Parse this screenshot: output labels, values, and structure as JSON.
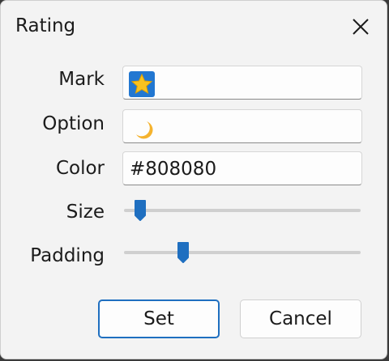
{
  "dialog": {
    "title": "Rating",
    "fields": {
      "mark_label": "Mark",
      "option_label": "Option",
      "color_label": "Color",
      "color_value": "#808080",
      "size_label": "Size",
      "padding_label": "Padding"
    },
    "sliders": {
      "size_level": 0.07,
      "padding_level": 0.25
    },
    "buttons": {
      "set": "Set",
      "cancel": "Cancel"
    },
    "icons": {
      "mark": "star-icon",
      "option": "crescent-moon-icon",
      "close": "close-icon"
    },
    "colors": {
      "accent": "#1f6fc0",
      "star": "#f9c21f",
      "star_bg": "#2277d1",
      "moon": "#f5b32e"
    }
  }
}
